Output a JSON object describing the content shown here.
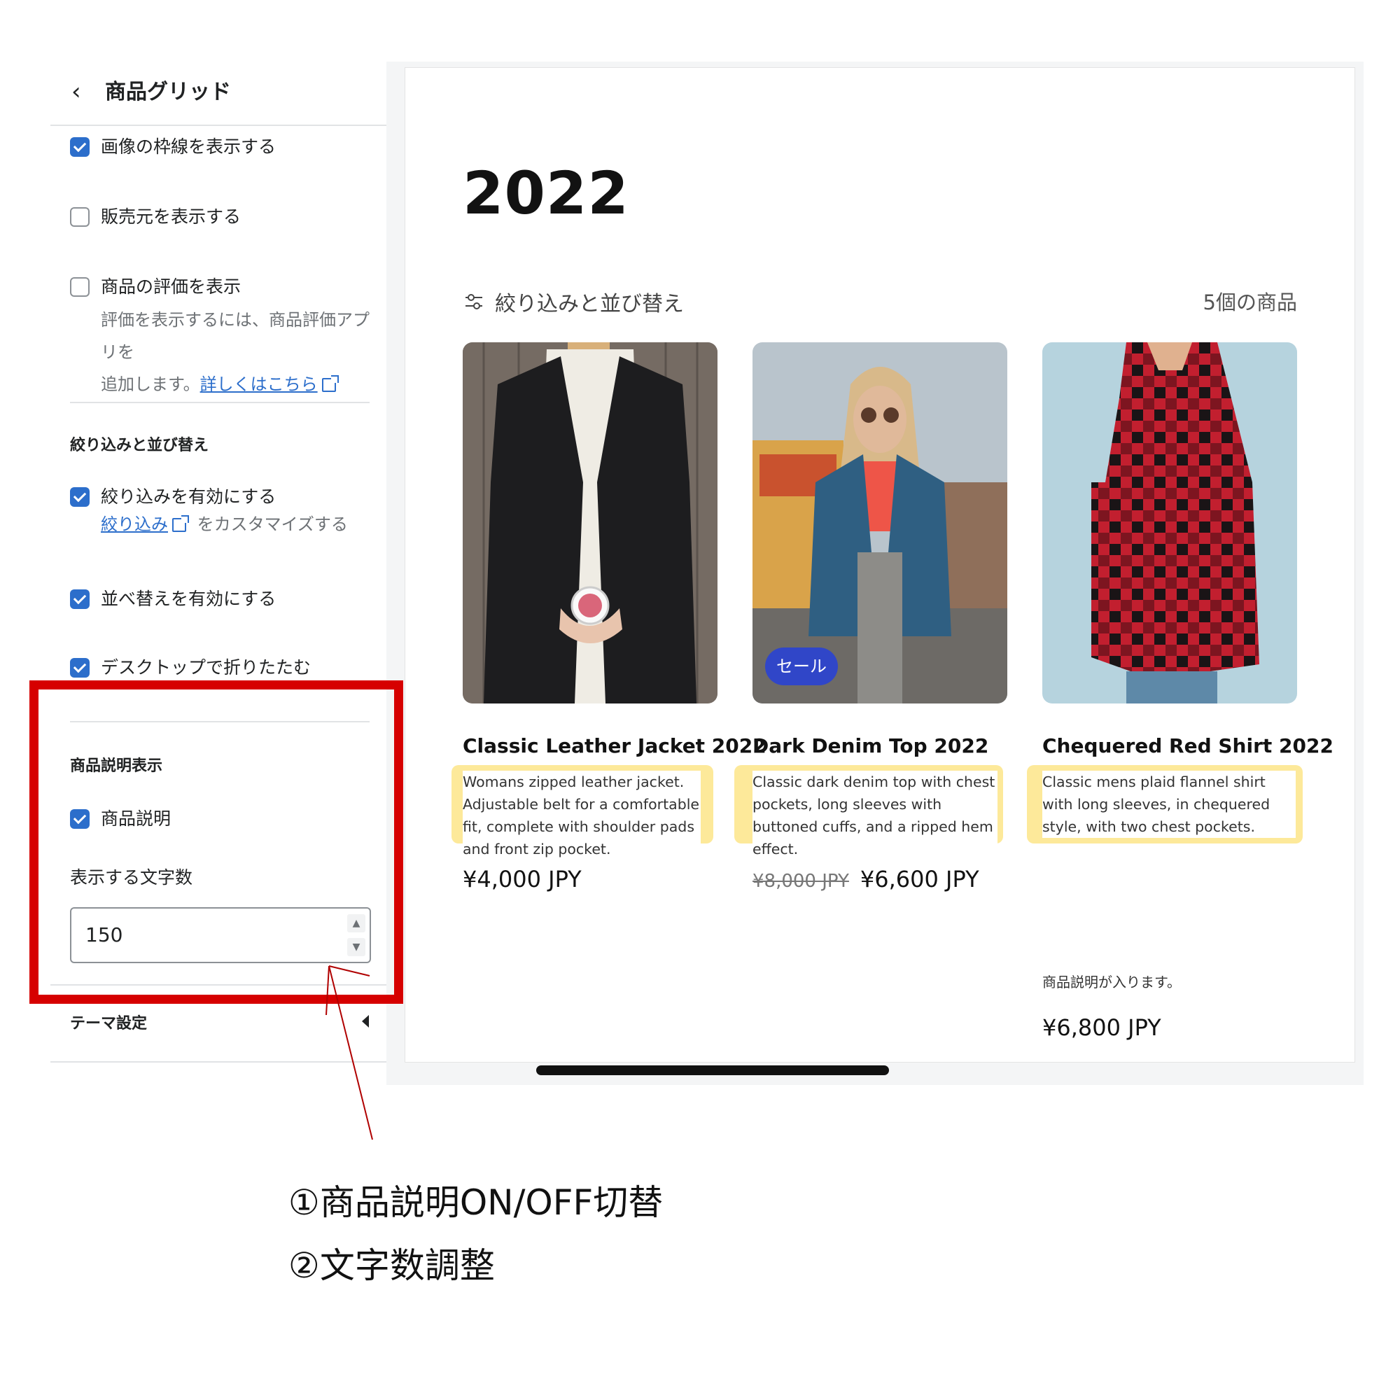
{
  "sidebar": {
    "title": "商品グリッド",
    "options": [
      {
        "label": "画像の枠線を表示する",
        "checked": true
      },
      {
        "label": "販売元を表示する",
        "checked": false
      },
      {
        "label": "商品の評価を表示",
        "checked": false
      }
    ],
    "rating_help": {
      "text1": "評価を表示するには、商品評価アプリを",
      "text2": "追加します。",
      "link": "詳しくはこちら"
    },
    "filter_section": {
      "heading": "絞り込みと並び替え",
      "enable_filter": "絞り込みを有効にする",
      "filter_link": "絞り込み",
      "filter_help": "をカスタマイズする",
      "enable_sort": "並べ替えを有効にする",
      "collapse_desktop": "デスクトップで折りたたむ"
    },
    "description_section": {
      "heading": "商品説明表示",
      "toggle_label": "商品説明",
      "count_label": "表示する文字数",
      "count_value": "150"
    },
    "theme_settings": "テーマ設定"
  },
  "preview": {
    "collection_title": "2022",
    "filter_label": "絞り込みと並び替え",
    "product_count": "5個の商品",
    "products": [
      {
        "title": "Classic Leather Jacket 2022",
        "description": "Womans zipped leather jacket. Adjustable belt for a comfortable fit, complete with shoulder pads and front zip pocket.",
        "price": "¥4,000 JPY"
      },
      {
        "title": "Dark Denim Top 2022",
        "description": "Classic dark denim top with chest pockets, long sleeves with buttoned cuffs, and a ripped hem effect.",
        "badge": "セール",
        "compare_price": "¥8,000 JPY",
        "price": "¥6,600 JPY"
      },
      {
        "title": "Chequered Red Shirt 2022",
        "description": "Classic mens plaid flannel shirt with long sleeves, in chequered style, with two chest pockets.",
        "note": "商品説明が入ります。",
        "price": "¥6,800 JPY"
      }
    ]
  },
  "annotation": {
    "line1": "①商品説明ON/OFF切替",
    "line2": "②文字数調整"
  },
  "colors": {
    "highlight_red": "#d60000",
    "desc_highlight": "#fde99a",
    "accent_blue": "#2c6ecb",
    "sale_badge": "#3046c8"
  }
}
